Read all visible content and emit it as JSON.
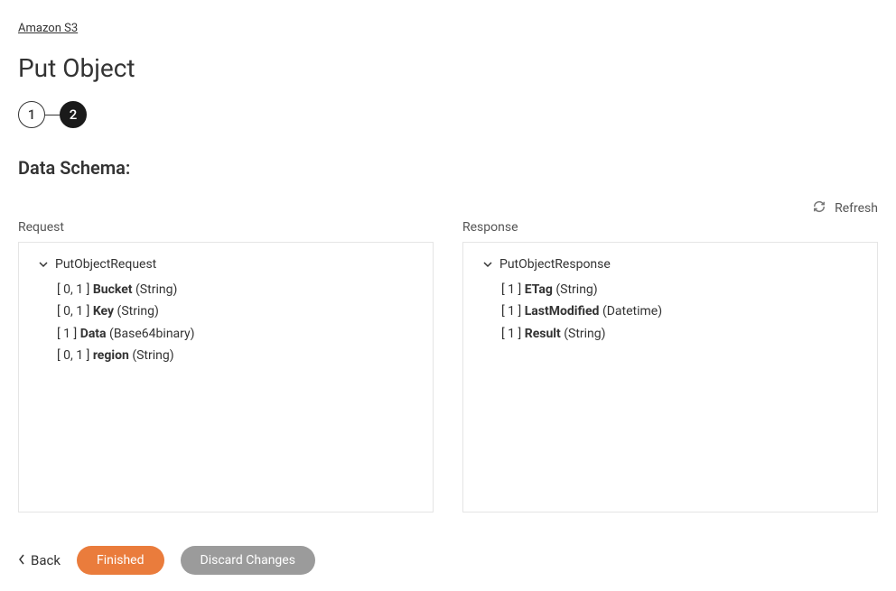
{
  "breadcrumb": {
    "label": "Amazon S3"
  },
  "page": {
    "title": "Put Object"
  },
  "stepper": {
    "steps": [
      "1",
      "2"
    ],
    "active_index": 1
  },
  "section": {
    "title": "Data Schema:"
  },
  "toolbar": {
    "refresh_label": "Refresh"
  },
  "request": {
    "label": "Request",
    "root_name": "PutObjectRequest",
    "fields": [
      {
        "cardinality": "[ 0, 1 ]",
        "name": "Bucket",
        "type": "(String)"
      },
      {
        "cardinality": "[ 0, 1 ]",
        "name": "Key",
        "type": "(String)"
      },
      {
        "cardinality": "[ 1 ]",
        "name": "Data",
        "type": "(Base64binary)"
      },
      {
        "cardinality": "[ 0, 1 ]",
        "name": "region",
        "type": "(String)"
      }
    ]
  },
  "response": {
    "label": "Response",
    "root_name": "PutObjectResponse",
    "fields": [
      {
        "cardinality": "[ 1 ]",
        "name": "ETag",
        "type": "(String)"
      },
      {
        "cardinality": "[ 1 ]",
        "name": "LastModified",
        "type": "(Datetime)"
      },
      {
        "cardinality": "[ 1 ]",
        "name": "Result",
        "type": "(String)"
      }
    ]
  },
  "footer": {
    "back_label": "Back",
    "finished_label": "Finished",
    "discard_label": "Discard Changes"
  }
}
